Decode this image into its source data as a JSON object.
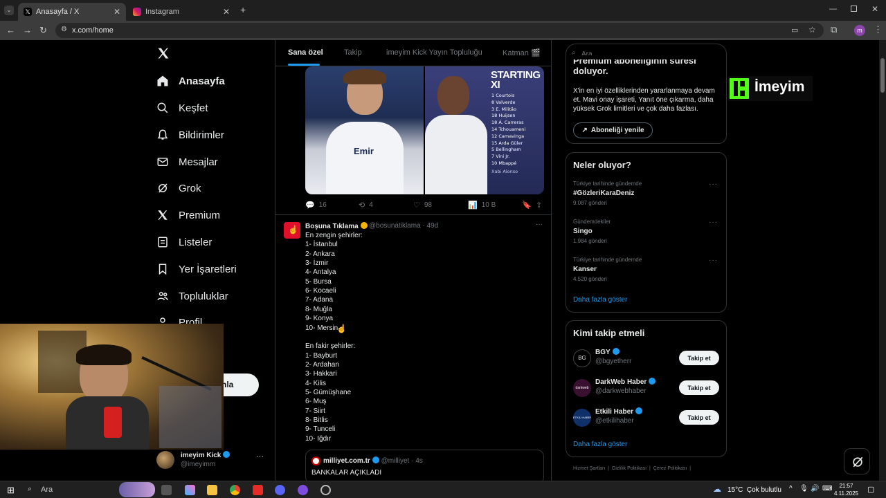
{
  "browser": {
    "tabs": [
      {
        "label": "Anasayfa / X",
        "active": true
      },
      {
        "label": "Instagram",
        "active": false
      }
    ],
    "new_tab": "+",
    "url": "x.com/home",
    "profile_initial": "m"
  },
  "left_nav": {
    "items": [
      {
        "label": "Anasayfa",
        "icon": "home-icon"
      },
      {
        "label": "Keşfet",
        "icon": "search-icon"
      },
      {
        "label": "Bildirimler",
        "icon": "bell-icon"
      },
      {
        "label": "Mesajlar",
        "icon": "mail-icon"
      },
      {
        "label": "Grok",
        "icon": "grok-icon"
      },
      {
        "label": "Premium",
        "icon": "x-icon"
      },
      {
        "label": "Listeler",
        "icon": "list-icon"
      },
      {
        "label": "Yer İşaretleri",
        "icon": "bookmark-icon"
      },
      {
        "label": "Topluluklar",
        "icon": "people-icon"
      },
      {
        "label": "Profil",
        "icon": "profile-icon"
      }
    ],
    "post_button_partial": "nla",
    "account": {
      "name": "imeyim Kick",
      "handle": "@imeyimm",
      "more": "···"
    }
  },
  "timeline": {
    "tabs": [
      "Sana özel",
      "Takip",
      "imeyim Kick Yayın Topluluğu",
      "Katman 🎬"
    ],
    "media": {
      "starting_title": "STARTING XI",
      "lineup": [
        "1  Courtois",
        "8  Valverde",
        "3  E. Militão",
        "18 Huijsen",
        "18 Á. Carreras",
        "14 Tchouameni",
        "12 Camavinga",
        "15 Arda Güler",
        "5  Bellingham",
        "7  Vini Jr.",
        "10 Mbappé"
      ],
      "coach": "Xabi Alonso"
    },
    "tweet1_actions": {
      "replies": "16",
      "reposts": "4",
      "likes": "98",
      "views": "10 B"
    },
    "tweet2": {
      "name": "Boşuna Tıklama",
      "handle": "@bosunatiklama",
      "time": "· 49d",
      "more": "···",
      "lines": [
        "En zengin şehirler:",
        "1- İstanbul",
        "2- Ankara",
        "3- İzmir",
        "4- Antalya",
        "5- Bursa",
        "6- Kocaeli",
        "7- Adana",
        "8- Muğla",
        "9- Konya",
        "10- Mersin",
        "",
        "En fakir şehirler:",
        "1- Bayburt",
        "2- Ardahan",
        "3- Hakkari",
        "4- Kilis",
        "5- Gümüşhane",
        "6- Muş",
        "7- Siirt",
        "8- Bitlis",
        "9- Tunceli",
        "10- Iğdır"
      ],
      "quote": {
        "name": "milliyet.com.tr",
        "handle": "@milliyet",
        "time": "· 4s",
        "text": "BANKALAR AÇIKLADI"
      }
    }
  },
  "right": {
    "search_placeholder": "Ara",
    "premium": {
      "title_line1": "Premium aboneliğinin süresi",
      "title_line2": "doluyor.",
      "body": "X'in en iyi özelliklerinden yararlanmaya devam et. Mavi onay işareti, Yanıt öne çıkarma, daha yüksek Grok limitleri ve çok daha fazlası.",
      "button": "Aboneliği yenile"
    },
    "trends": {
      "title": "Neler oluyor?",
      "items": [
        {
          "context": "Türkiye tarihinde gündemde",
          "topic": "#GözleriKaraDeniz",
          "count": "9.087 gönderi"
        },
        {
          "context": "Gündemdekiler",
          "topic": "Singo",
          "count": "1.984 gönderi"
        },
        {
          "context": "Türkiye tarihinde gündemde",
          "topic": "Kanser",
          "count": "4.520 gönderi"
        }
      ],
      "more": "Daha fazla göster"
    },
    "who_to_follow": {
      "title": "Kimi takip etmeli",
      "items": [
        {
          "name": "BGY",
          "handle": "@bgyetherr",
          "button": "Takip et",
          "avatar_text": "BG"
        },
        {
          "name": "DarkWeb Haber",
          "handle": "@darkwebhaber",
          "button": "Takip et",
          "avatar_text": "darkweb"
        },
        {
          "name": "Etkili Haber",
          "handle": "@etkilihaber",
          "button": "Takip et",
          "avatar_text": "ETKİLİ HABER"
        }
      ],
      "more": "Daha fazla göster"
    },
    "footer": [
      "Hizmet Şartları",
      "Gizlilik Politikası",
      "Çerez Politikası"
    ]
  },
  "stream_overlay": {
    "brand": "İmeyim"
  },
  "taskbar": {
    "search": "Ara",
    "weather": "15°C  Çok bulutlu",
    "time": "21:57",
    "date": "4.11.2025"
  },
  "colors": {
    "accent": "#1d9bf0",
    "kick_green": "#53fc18",
    "border": "#2f3336"
  }
}
